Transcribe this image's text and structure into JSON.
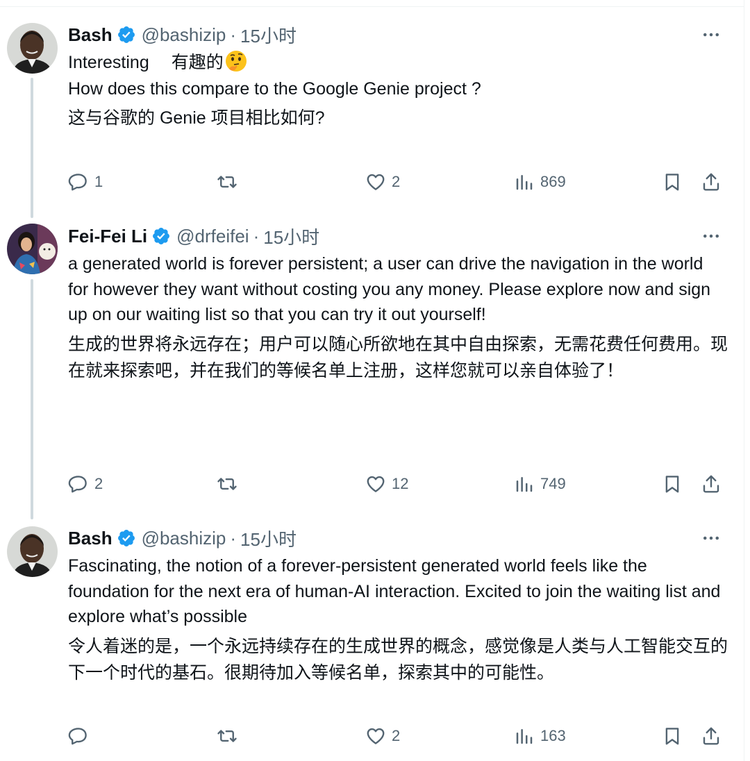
{
  "colors": {
    "verified": "#1d9bf0",
    "secondary_text": "#536471",
    "thread_line": "#cfd9de"
  },
  "posts": [
    {
      "name": "Bash",
      "handle": "@bashizip",
      "separator": "·",
      "time": "15小时",
      "text_en_lead": "Interesting",
      "text_zh_lead": "有趣的",
      "lead_emoji": "thinking-face-emoji",
      "text_en": "How does this compare to the Google Genie project ?",
      "text_zh": "这与谷歌的 Genie 项目相比如何?",
      "stats": {
        "replies": "1",
        "reposts": "",
        "likes": "2",
        "views": "869"
      }
    },
    {
      "name": "Fei-Fei Li",
      "handle": "@drfeifei",
      "separator": "·",
      "time": "15小时",
      "text_en": "a generated world is forever persistent; a user can drive the navigation in the world for however they want without costing you any money. Please explore now and sign up on our waiting list so that you can try it out yourself!",
      "text_zh": "生成的世界将永远存在；用户可以随心所欲地在其中自由探索，无需花费任何费用。现在就来探索吧，并在我们的等候名单上注册，这样您就可以亲自体验了！",
      "stats": {
        "replies": "2",
        "reposts": "",
        "likes": "12",
        "views": "749"
      }
    },
    {
      "name": "Bash",
      "handle": "@bashizip",
      "separator": "·",
      "time": "15小时",
      "text_en": "Fascinating, the notion of a forever-persistent generated world feels like the foundation for the next era of human-AI interaction. Excited to join the waiting list and explore what’s possible",
      "text_zh": "令人着迷的是，一个永远持续存在的生成世界的概念，感觉像是人类与人工智能交互的下一个时代的基石。很期待加入等候名单，探索其中的可能性。",
      "stats": {
        "replies": "",
        "reposts": "",
        "likes": "2",
        "views": "163"
      }
    }
  ]
}
